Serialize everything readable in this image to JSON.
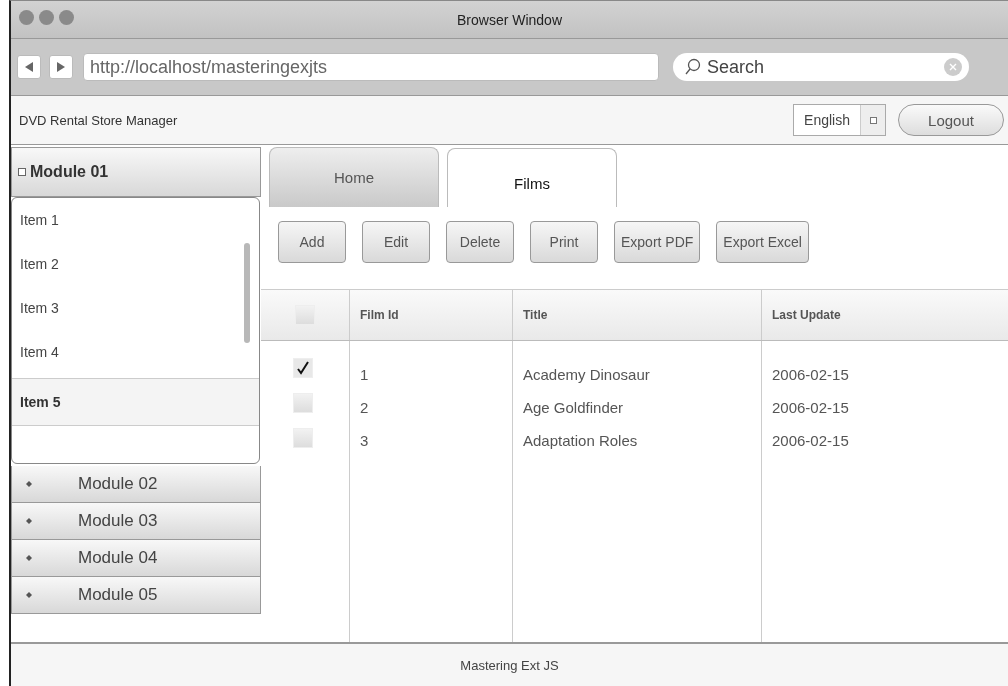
{
  "window": {
    "title": "Browser Window"
  },
  "address_bar": {
    "value": "http://localhost/masteringexjts"
  },
  "search": {
    "placeholder": "Search"
  },
  "app_header": {
    "title": "DVD Rental Store Manager",
    "language": "English",
    "logout": "Logout"
  },
  "sidebar": {
    "modules": [
      {
        "title": "Module 01",
        "expanded": true,
        "items": [
          {
            "label": "Item 1",
            "selected": false
          },
          {
            "label": "Item 2",
            "selected": false
          },
          {
            "label": "Item 3",
            "selected": false
          },
          {
            "label": "Item 4",
            "selected": false
          },
          {
            "label": "Item 5",
            "selected": true
          }
        ]
      },
      {
        "title": "Module 02",
        "expanded": false
      },
      {
        "title": "Module 03",
        "expanded": false
      },
      {
        "title": "Module 04",
        "expanded": false
      },
      {
        "title": "Module 05",
        "expanded": false
      }
    ]
  },
  "tabs": [
    {
      "label": "Home",
      "selected": false
    },
    {
      "label": "Films",
      "selected": true
    }
  ],
  "toolbar": [
    "Add",
    "Edit",
    "Delete",
    "Print",
    "Export PDF",
    "Export Excel"
  ],
  "table": {
    "select_all": false,
    "columns": [
      "Film Id",
      "Title",
      "Last Update"
    ],
    "rows": [
      {
        "checked": true,
        "cells": [
          "1",
          "Academy Dinosaur",
          "2006-02-15"
        ]
      },
      {
        "checked": false,
        "cells": [
          "2",
          "Age Goldfinder",
          "2006-02-15"
        ]
      },
      {
        "checked": false,
        "cells": [
          "3",
          "Adaptation Roles",
          "2006-02-15"
        ]
      }
    ]
  },
  "footer": "Mastering Ext JS"
}
